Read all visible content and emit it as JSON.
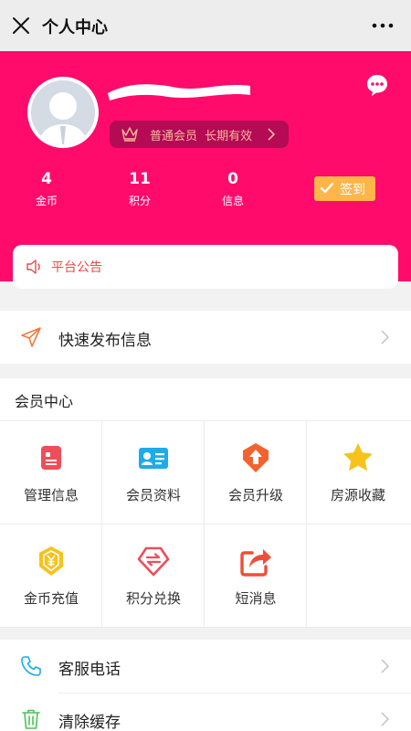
{
  "navbar": {
    "title": "个人中心"
  },
  "profile": {
    "member_level": "普通会员",
    "member_validity": "长期有效",
    "stats": [
      {
        "value": "4",
        "label": "金币"
      },
      {
        "value": "11",
        "label": "积分"
      },
      {
        "value": "0",
        "label": "信息"
      }
    ],
    "signin_label": "签到"
  },
  "notice": {
    "label": "平台公告"
  },
  "quick_publish": {
    "label": "快速发布信息"
  },
  "member_center": {
    "title": "会员中心",
    "items": [
      {
        "label": "管理信息",
        "icon": "manage-info-icon"
      },
      {
        "label": "会员资料",
        "icon": "member-profile-icon"
      },
      {
        "label": "会员升级",
        "icon": "upgrade-icon"
      },
      {
        "label": "房源收藏",
        "icon": "star-icon"
      },
      {
        "label": "金币充值",
        "icon": "coin-recharge-icon"
      },
      {
        "label": "积分兑换",
        "icon": "points-exchange-icon"
      },
      {
        "label": "短消息",
        "icon": "share-message-icon"
      }
    ]
  },
  "service": {
    "phone_label": "客服电话",
    "clear_cache_label": "清除缓存"
  },
  "colors": {
    "brand_pink": "#ff0b6c",
    "badge_bg": "#b50a54",
    "signin_orange": "#ffb549",
    "notice_red": "#e64b4b"
  }
}
